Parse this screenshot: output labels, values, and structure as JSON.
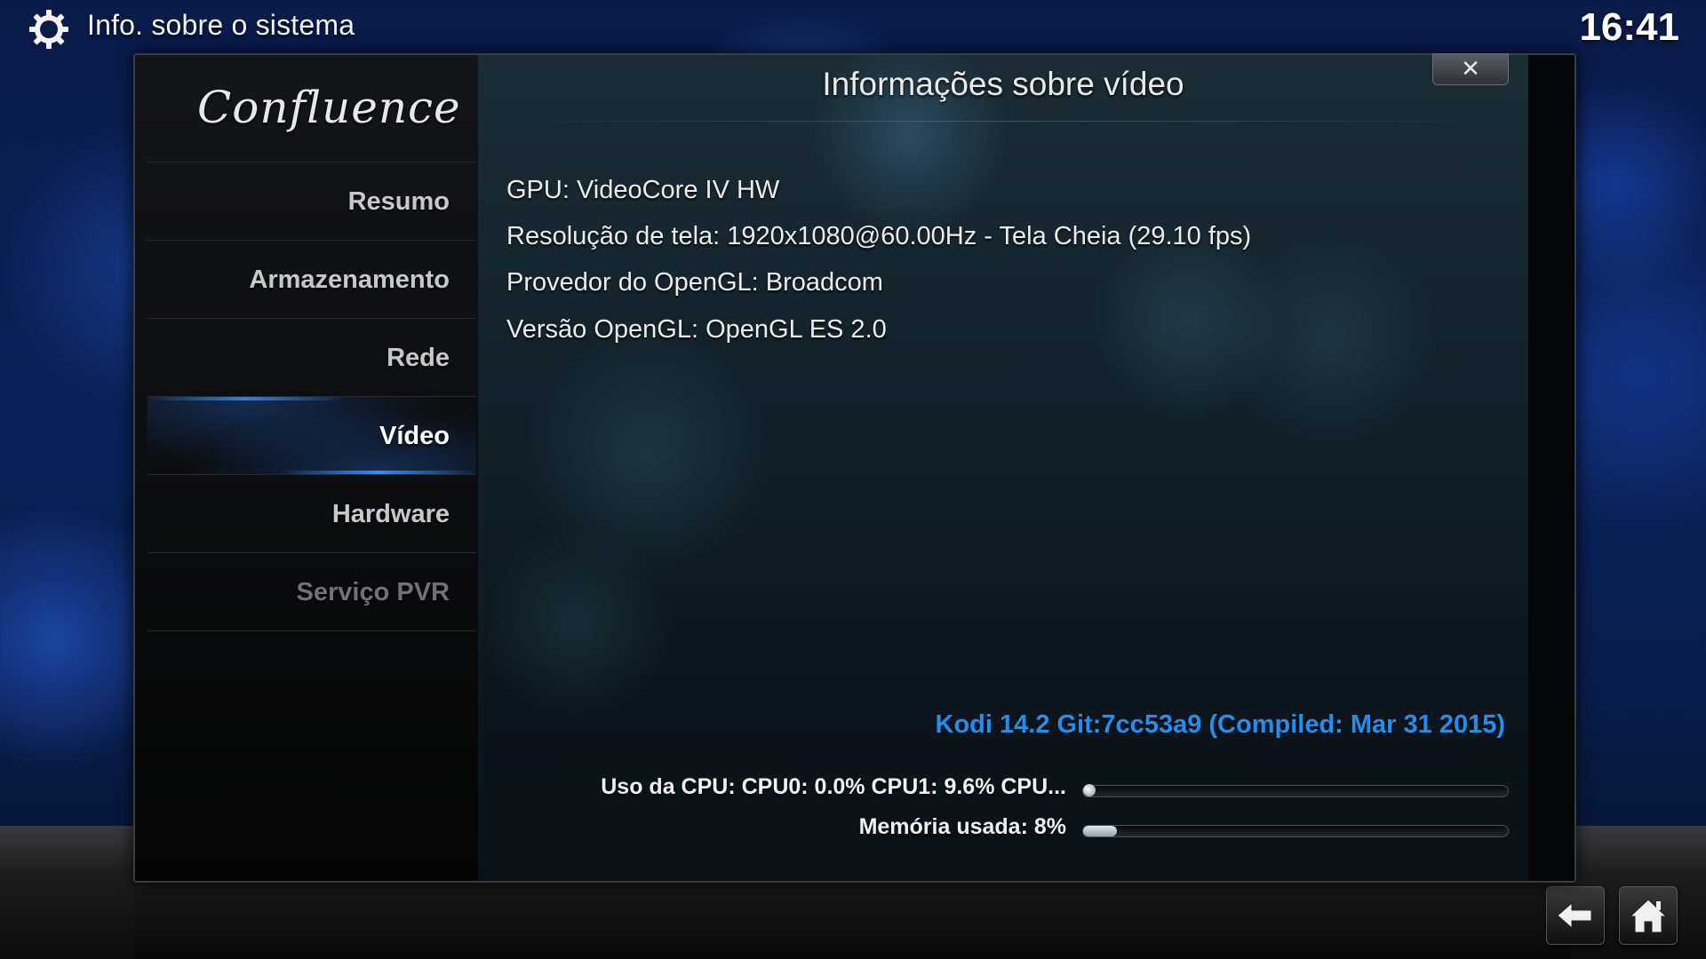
{
  "header": {
    "title": "Info. sobre o sistema",
    "clock": "16:41",
    "icon": "gear-icon"
  },
  "sidebar": {
    "logo": "Confluence",
    "items": [
      {
        "label": "Resumo",
        "state": "normal"
      },
      {
        "label": "Armazenamento",
        "state": "normal"
      },
      {
        "label": "Rede",
        "state": "normal"
      },
      {
        "label": "Vídeo",
        "state": "selected"
      },
      {
        "label": "Hardware",
        "state": "normal"
      },
      {
        "label": "Serviço PVR",
        "state": "disabled"
      }
    ]
  },
  "dialog": {
    "title": "Informações sobre vídeo",
    "close_label": "✕",
    "lines": [
      "GPU: VideoCore IV HW",
      "Resolução de tela: 1920x1080@60.00Hz - Tela Cheia (29.10 fps)",
      "Provedor do OpenGL: Broadcom",
      "Versão OpenGL: OpenGL ES 2.0"
    ],
    "build": "Kodi 14.2 Git:7cc53a9 (Compiled: Mar 31 2015)",
    "meters": [
      {
        "label": "Uso da CPU: CPU0: 0.0% CPU1: 9.6% CPU...",
        "fraction": 0.0
      },
      {
        "label": "Memória usada: 8%",
        "fraction": 0.08
      }
    ]
  },
  "footer": {
    "back_icon": "back-arrow-icon",
    "home_icon": "home-icon"
  },
  "colors": {
    "accent_blue": "#1e90f0",
    "text": "#ececec",
    "background": "#0a2259"
  }
}
